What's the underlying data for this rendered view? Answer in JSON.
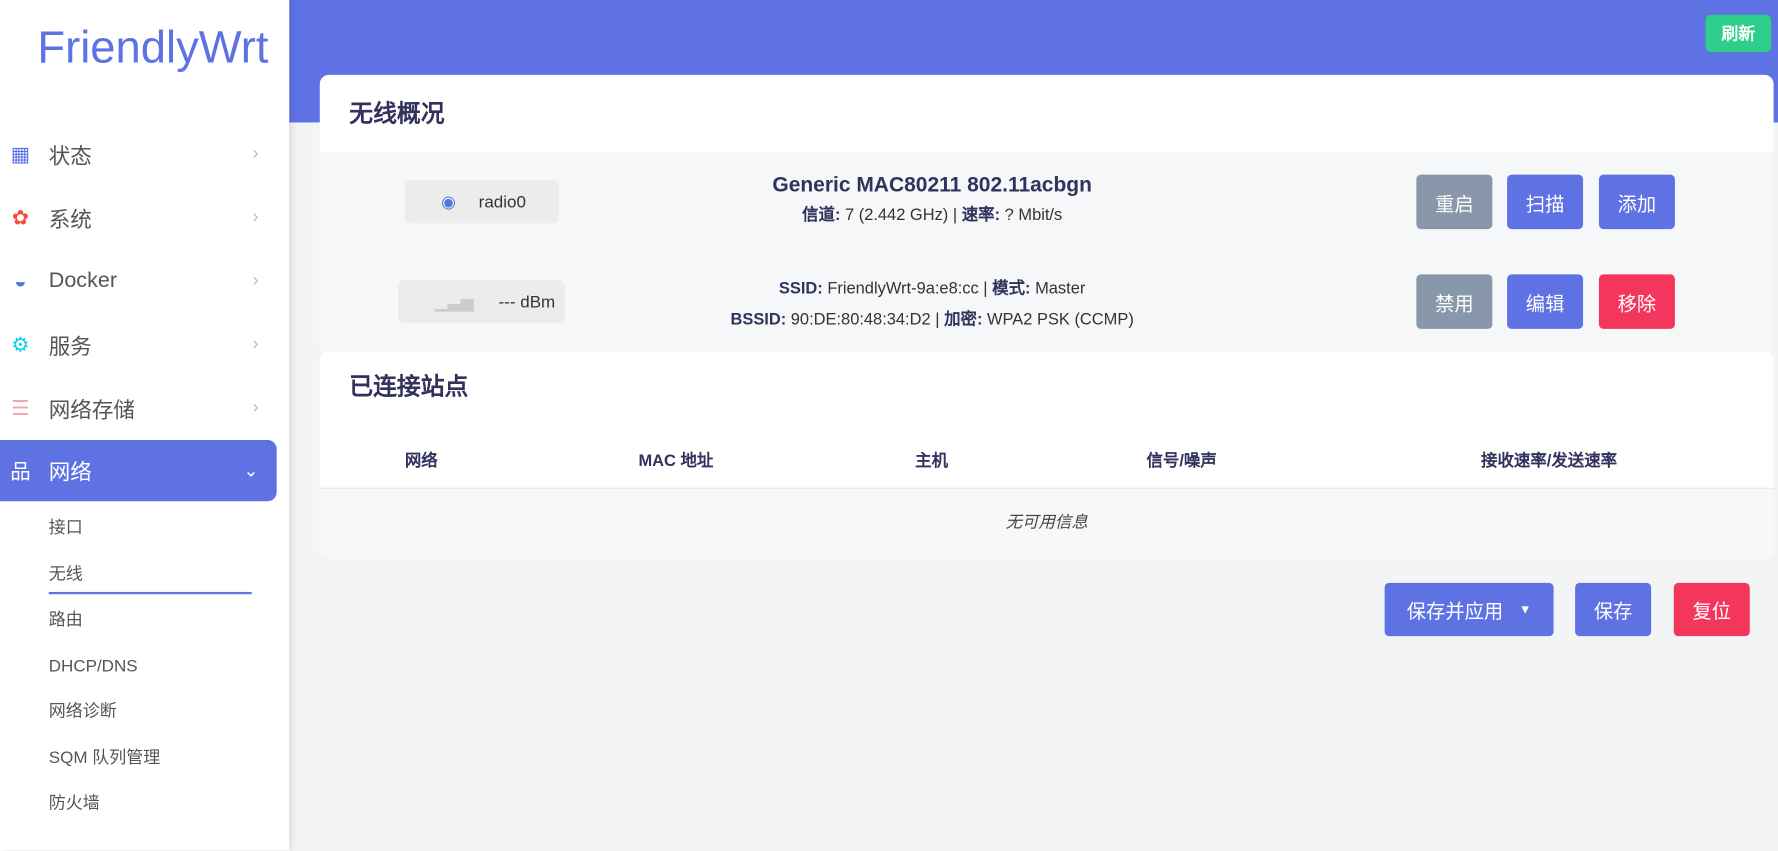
{
  "app": {
    "logo": "FriendlyWrt",
    "refresh_label": "刷新"
  },
  "sidebar": {
    "items": [
      {
        "label": "状态",
        "icon": "dashboard-icon"
      },
      {
        "label": "系统",
        "icon": "gear-icon"
      },
      {
        "label": "Docker",
        "icon": "docker-icon"
      },
      {
        "label": "服务",
        "icon": "gears-icon"
      },
      {
        "label": "网络存储",
        "icon": "database-icon"
      },
      {
        "label": "网络",
        "icon": "network-icon"
      }
    ],
    "subitems": [
      "接口",
      "无线",
      "路由",
      "DHCP/DNS",
      "网络诊断",
      "SQM 队列管理",
      "防火墙"
    ]
  },
  "wireless": {
    "title": "无线概况",
    "radio": {
      "name": "radio0",
      "model": "Generic MAC80211 802.11acbgn",
      "channel_label": "信道:",
      "channel": "7 (2.442 GHz)",
      "rate_label": "速率:",
      "rate": "? Mbit/s",
      "buttons": [
        "重启",
        "扫描",
        "添加"
      ]
    },
    "network": {
      "signal": "--- dBm",
      "ssid_label": "SSID:",
      "ssid": "FriendlyWrt-9a:e8:cc",
      "mode_label": "模式:",
      "mode": "Master",
      "bssid_label": "BSSID:",
      "bssid": "90:DE:80:48:34:D2",
      "enc_label": "加密:",
      "enc": "WPA2 PSK (CCMP)",
      "buttons": [
        "禁用",
        "编辑",
        "移除"
      ]
    }
  },
  "stations": {
    "title": "已连接站点",
    "columns": [
      "网络",
      "MAC 地址",
      "主机",
      "信号/噪声",
      "接收速率/发送速率"
    ],
    "empty": "无可用信息"
  },
  "footer": {
    "save_apply": "保存并应用",
    "save": "保存",
    "reset": "复位"
  }
}
